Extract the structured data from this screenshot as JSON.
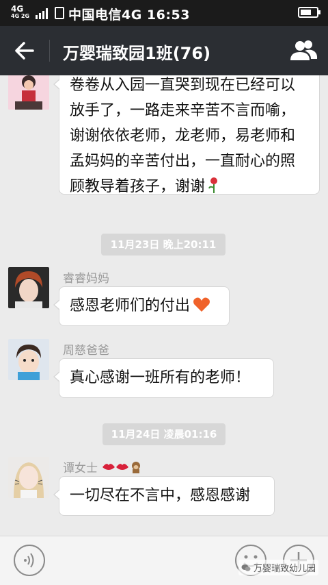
{
  "status_bar": {
    "network_top": "4G",
    "network_small": "4G 2G",
    "carrier_time": "中国电信4G 16:53"
  },
  "nav": {
    "title": "万婴瑞致园1班(76)"
  },
  "messages": [
    {
      "sender": "",
      "text": "卷卷从入园一直哭到现在已经可以放手了，一路走来辛苦不言而喻，谢谢依依老师，龙老师，易老师和孟妈妈的辛苦付出，一直耐心的照顾教导着孩子，谢谢",
      "emoji": "rose"
    },
    {
      "sender": "睿睿妈妈",
      "text": "感恩老师们的付出",
      "emoji": "heart"
    },
    {
      "sender": "周慈爸爸",
      "text": "真心感谢一班所有的老师！"
    },
    {
      "sender": "谭女士",
      "sender_emojis": [
        "lips",
        "lips",
        "monkey"
      ],
      "text": "一切尽在不言中，感恩感谢"
    }
  ],
  "timestamps": [
    "11月23日 晚上20:11",
    "11月24日 凌晨01:16"
  ],
  "watermark": "万婴瑞致幼儿园",
  "colors": {
    "nav_bg": "#2b2e33",
    "status_bg": "#1b1b1b",
    "chat_bg": "#ebebeb",
    "bubble_bg": "#ffffff",
    "timestamp_bg": "#d7d7d7"
  }
}
